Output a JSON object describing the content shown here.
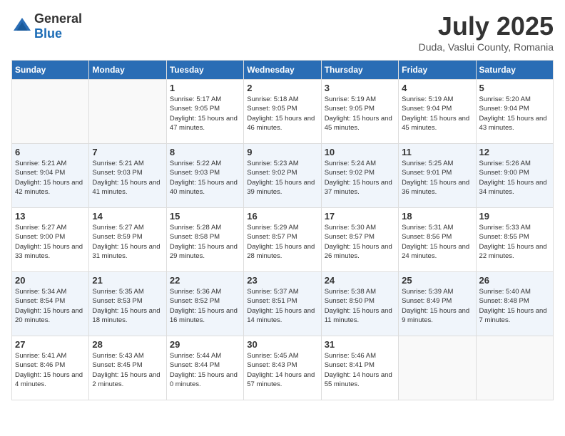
{
  "header": {
    "logo_general": "General",
    "logo_blue": "Blue",
    "month": "July 2025",
    "location": "Duda, Vaslui County, Romania"
  },
  "days_of_week": [
    "Sunday",
    "Monday",
    "Tuesday",
    "Wednesday",
    "Thursday",
    "Friday",
    "Saturday"
  ],
  "weeks": [
    [
      {
        "day": "",
        "empty": true
      },
      {
        "day": "",
        "empty": true
      },
      {
        "day": "1",
        "sunrise": "Sunrise: 5:17 AM",
        "sunset": "Sunset: 9:05 PM",
        "daylight": "Daylight: 15 hours and 47 minutes."
      },
      {
        "day": "2",
        "sunrise": "Sunrise: 5:18 AM",
        "sunset": "Sunset: 9:05 PM",
        "daylight": "Daylight: 15 hours and 46 minutes."
      },
      {
        "day": "3",
        "sunrise": "Sunrise: 5:19 AM",
        "sunset": "Sunset: 9:05 PM",
        "daylight": "Daylight: 15 hours and 45 minutes."
      },
      {
        "day": "4",
        "sunrise": "Sunrise: 5:19 AM",
        "sunset": "Sunset: 9:04 PM",
        "daylight": "Daylight: 15 hours and 45 minutes."
      },
      {
        "day": "5",
        "sunrise": "Sunrise: 5:20 AM",
        "sunset": "Sunset: 9:04 PM",
        "daylight": "Daylight: 15 hours and 43 minutes."
      }
    ],
    [
      {
        "day": "6",
        "sunrise": "Sunrise: 5:21 AM",
        "sunset": "Sunset: 9:04 PM",
        "daylight": "Daylight: 15 hours and 42 minutes."
      },
      {
        "day": "7",
        "sunrise": "Sunrise: 5:21 AM",
        "sunset": "Sunset: 9:03 PM",
        "daylight": "Daylight: 15 hours and 41 minutes."
      },
      {
        "day": "8",
        "sunrise": "Sunrise: 5:22 AM",
        "sunset": "Sunset: 9:03 PM",
        "daylight": "Daylight: 15 hours and 40 minutes."
      },
      {
        "day": "9",
        "sunrise": "Sunrise: 5:23 AM",
        "sunset": "Sunset: 9:02 PM",
        "daylight": "Daylight: 15 hours and 39 minutes."
      },
      {
        "day": "10",
        "sunrise": "Sunrise: 5:24 AM",
        "sunset": "Sunset: 9:02 PM",
        "daylight": "Daylight: 15 hours and 37 minutes."
      },
      {
        "day": "11",
        "sunrise": "Sunrise: 5:25 AM",
        "sunset": "Sunset: 9:01 PM",
        "daylight": "Daylight: 15 hours and 36 minutes."
      },
      {
        "day": "12",
        "sunrise": "Sunrise: 5:26 AM",
        "sunset": "Sunset: 9:00 PM",
        "daylight": "Daylight: 15 hours and 34 minutes."
      }
    ],
    [
      {
        "day": "13",
        "sunrise": "Sunrise: 5:27 AM",
        "sunset": "Sunset: 9:00 PM",
        "daylight": "Daylight: 15 hours and 33 minutes."
      },
      {
        "day": "14",
        "sunrise": "Sunrise: 5:27 AM",
        "sunset": "Sunset: 8:59 PM",
        "daylight": "Daylight: 15 hours and 31 minutes."
      },
      {
        "day": "15",
        "sunrise": "Sunrise: 5:28 AM",
        "sunset": "Sunset: 8:58 PM",
        "daylight": "Daylight: 15 hours and 29 minutes."
      },
      {
        "day": "16",
        "sunrise": "Sunrise: 5:29 AM",
        "sunset": "Sunset: 8:57 PM",
        "daylight": "Daylight: 15 hours and 28 minutes."
      },
      {
        "day": "17",
        "sunrise": "Sunrise: 5:30 AM",
        "sunset": "Sunset: 8:57 PM",
        "daylight": "Daylight: 15 hours and 26 minutes."
      },
      {
        "day": "18",
        "sunrise": "Sunrise: 5:31 AM",
        "sunset": "Sunset: 8:56 PM",
        "daylight": "Daylight: 15 hours and 24 minutes."
      },
      {
        "day": "19",
        "sunrise": "Sunrise: 5:33 AM",
        "sunset": "Sunset: 8:55 PM",
        "daylight": "Daylight: 15 hours and 22 minutes."
      }
    ],
    [
      {
        "day": "20",
        "sunrise": "Sunrise: 5:34 AM",
        "sunset": "Sunset: 8:54 PM",
        "daylight": "Daylight: 15 hours and 20 minutes."
      },
      {
        "day": "21",
        "sunrise": "Sunrise: 5:35 AM",
        "sunset": "Sunset: 8:53 PM",
        "daylight": "Daylight: 15 hours and 18 minutes."
      },
      {
        "day": "22",
        "sunrise": "Sunrise: 5:36 AM",
        "sunset": "Sunset: 8:52 PM",
        "daylight": "Daylight: 15 hours and 16 minutes."
      },
      {
        "day": "23",
        "sunrise": "Sunrise: 5:37 AM",
        "sunset": "Sunset: 8:51 PM",
        "daylight": "Daylight: 15 hours and 14 minutes."
      },
      {
        "day": "24",
        "sunrise": "Sunrise: 5:38 AM",
        "sunset": "Sunset: 8:50 PM",
        "daylight": "Daylight: 15 hours and 11 minutes."
      },
      {
        "day": "25",
        "sunrise": "Sunrise: 5:39 AM",
        "sunset": "Sunset: 8:49 PM",
        "daylight": "Daylight: 15 hours and 9 minutes."
      },
      {
        "day": "26",
        "sunrise": "Sunrise: 5:40 AM",
        "sunset": "Sunset: 8:48 PM",
        "daylight": "Daylight: 15 hours and 7 minutes."
      }
    ],
    [
      {
        "day": "27",
        "sunrise": "Sunrise: 5:41 AM",
        "sunset": "Sunset: 8:46 PM",
        "daylight": "Daylight: 15 hours and 4 minutes."
      },
      {
        "day": "28",
        "sunrise": "Sunrise: 5:43 AM",
        "sunset": "Sunset: 8:45 PM",
        "daylight": "Daylight: 15 hours and 2 minutes."
      },
      {
        "day": "29",
        "sunrise": "Sunrise: 5:44 AM",
        "sunset": "Sunset: 8:44 PM",
        "daylight": "Daylight: 15 hours and 0 minutes."
      },
      {
        "day": "30",
        "sunrise": "Sunrise: 5:45 AM",
        "sunset": "Sunset: 8:43 PM",
        "daylight": "Daylight: 14 hours and 57 minutes."
      },
      {
        "day": "31",
        "sunrise": "Sunrise: 5:46 AM",
        "sunset": "Sunset: 8:41 PM",
        "daylight": "Daylight: 14 hours and 55 minutes."
      },
      {
        "day": "",
        "empty": true
      },
      {
        "day": "",
        "empty": true
      }
    ]
  ]
}
